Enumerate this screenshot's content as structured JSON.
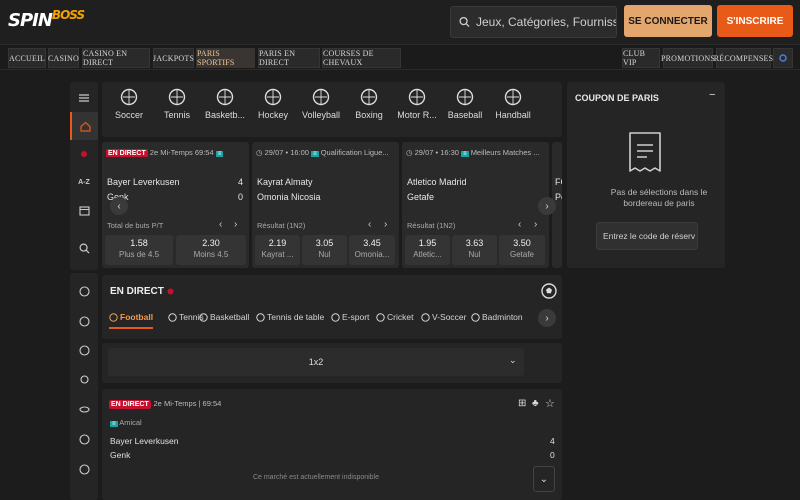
{
  "header": {
    "logo_main": "SPIN",
    "logo_accent": "BOSS",
    "search_placeholder": "Jeux, Catégories, Fournisseurs",
    "login": "SE CONNECTER",
    "signup": "S'INSCRIRE"
  },
  "nav": {
    "left": [
      "ACCUEIL",
      "CASINO",
      "CASINO EN DIRECT",
      "JACKPOTS",
      "PARIS SPORTIFS",
      "PARIS EN DIRECT",
      "COURSES DE CHEVAUX"
    ],
    "right": [
      "CLUB VIP",
      "PROMOTIONS",
      "RÉCOMPENSES"
    ],
    "active": "PARIS SPORTIFS"
  },
  "rail": {
    "az": "A-Z"
  },
  "sports": [
    "Soccer",
    "Tennis",
    "Basketb...",
    "Hockey",
    "Volleyball",
    "Boxing",
    "Motor R...",
    "Baseball",
    "Handball"
  ],
  "matches": [
    {
      "live": "EN DIRECT",
      "time": "2e Mi-Temps",
      "clock": "69:54",
      "team1": "Bayer Leverkusen",
      "score1": "4",
      "team2": "Genk",
      "score2": "0",
      "market": "Total de buts P/T",
      "odds": [
        {
          "value": "1.58",
          "label": "Plus de 4.5"
        },
        {
          "value": "2.30",
          "label": "Moins 4.5"
        }
      ]
    },
    {
      "date": "29/07 • 16:00",
      "league": "Qualification Ligue...",
      "team1": "Kayrat Almaty",
      "team2": "Omonia Nicosia",
      "market": "Résultat (1N2)",
      "odds": [
        {
          "value": "2.19",
          "label": "Kayrat ..."
        },
        {
          "value": "3.05",
          "label": "Nul"
        },
        {
          "value": "3.45",
          "label": "Omonia..."
        }
      ]
    },
    {
      "date": "29/07 • 16:30",
      "league": "Meilleurs Matches ...",
      "team1": "Atletico Madrid",
      "team2": "Getafe",
      "market": "Résultat (1N2)",
      "odds": [
        {
          "value": "1.95",
          "label": "Atletic..."
        },
        {
          "value": "3.63",
          "label": "Nul"
        },
        {
          "value": "3.50",
          "label": "Getafe"
        }
      ]
    }
  ],
  "partial_card": {
    "t1": "FC",
    "t2": "Po"
  },
  "coupon": {
    "title": "COUPON DE PARIS",
    "minimize": "−",
    "empty_text": "Pas de sélections dans le bordereau de paris",
    "code_placeholder": "Entrez le code de réserv"
  },
  "live": {
    "title": "EN DIRECT",
    "tabs": [
      "Football",
      "Tennis",
      "Basketball",
      "Tennis de table",
      "E-sport",
      "Cricket",
      "V-Soccer",
      "Badminton"
    ],
    "active_tab": "Football",
    "market": "1x2"
  },
  "event": {
    "live": "EN DIRECT",
    "status": "2e Mi-Temps | 69:54",
    "competition": "Amical",
    "team1": "Bayer Leverkusen",
    "score1": "4",
    "team2": "Genk",
    "score2": "0",
    "unavailable": "Ce marché est actuellement indisponible"
  },
  "colors": {
    "accent": "#e85a17",
    "login": "#e3a66d",
    "live": "#c8102e",
    "bg": "#1c1c1c",
    "panel": "#252525"
  }
}
